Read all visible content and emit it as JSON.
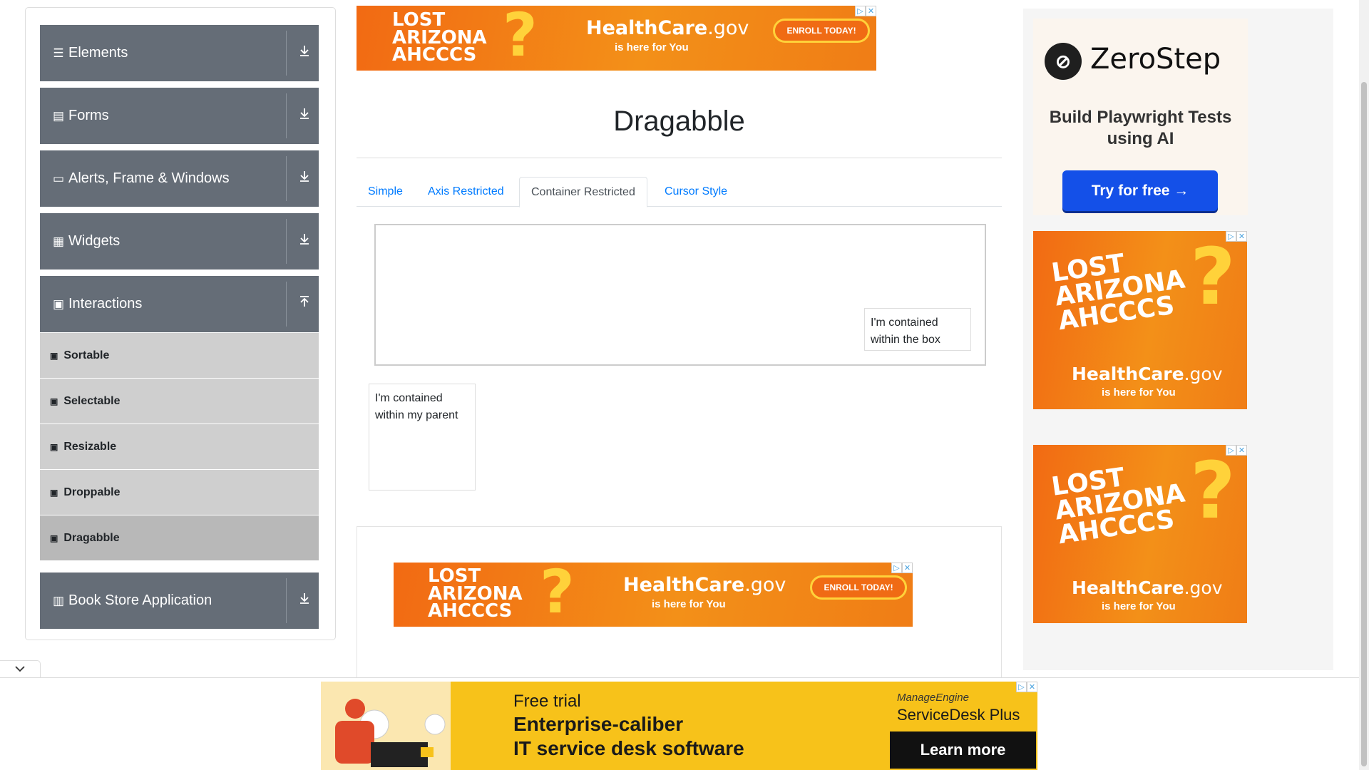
{
  "sidebar": {
    "groups": [
      {
        "label": "Elements",
        "icon": "list-icon"
      },
      {
        "label": "Forms",
        "icon": "form-icon"
      },
      {
        "label": "Alerts, Frame & Windows",
        "icon": "window-icon"
      },
      {
        "label": "Widgets",
        "icon": "widgets-icon"
      },
      {
        "label": "Interactions",
        "icon": "interactions-icon"
      },
      {
        "label": "Book Store Application",
        "icon": "book-icon"
      }
    ],
    "interactions_items": [
      "Sortable",
      "Selectable",
      "Resizable",
      "Droppable",
      "Dragabble"
    ],
    "active_item": "Dragabble"
  },
  "main": {
    "title": "Dragabble",
    "tabs": [
      "Simple",
      "Axis Restricted",
      "Container Restricted",
      "Cursor Style"
    ],
    "active_tab": "Container Restricted",
    "box_drag_text": "I'm contained within the box",
    "parent_drag_text": "I'm contained within my parent"
  },
  "ads": {
    "arizona": {
      "lost_line1": "LOST",
      "lost_line2": "ARIZONA",
      "lost_line3": "AHCCCS",
      "healthcare": "HealthCare",
      "gov": ".gov",
      "subline": "is here for You",
      "enroll": "ENROLL TODAY!"
    },
    "zerostep": {
      "brand": "ZeroStep",
      "tagline": "Build Playwright Tests using AI",
      "button": "Try for free →"
    },
    "servicedesk": {
      "line1": "Free trial",
      "line2": "Enterprise-caliber",
      "line3": "IT service desk software",
      "brand_small": "ManageEngine",
      "brand_big": "ServiceDesk Plus",
      "button": "Learn more"
    }
  },
  "colors": {
    "sidebar_header": "#656d77",
    "menu_item": "#cfcfcf",
    "menu_item_active": "#b8b8b8",
    "link_blue": "#007bff",
    "ad_orange": "#f26a13",
    "zerostep_button": "#1450e8",
    "banner_yellow": "#f7c21a"
  }
}
